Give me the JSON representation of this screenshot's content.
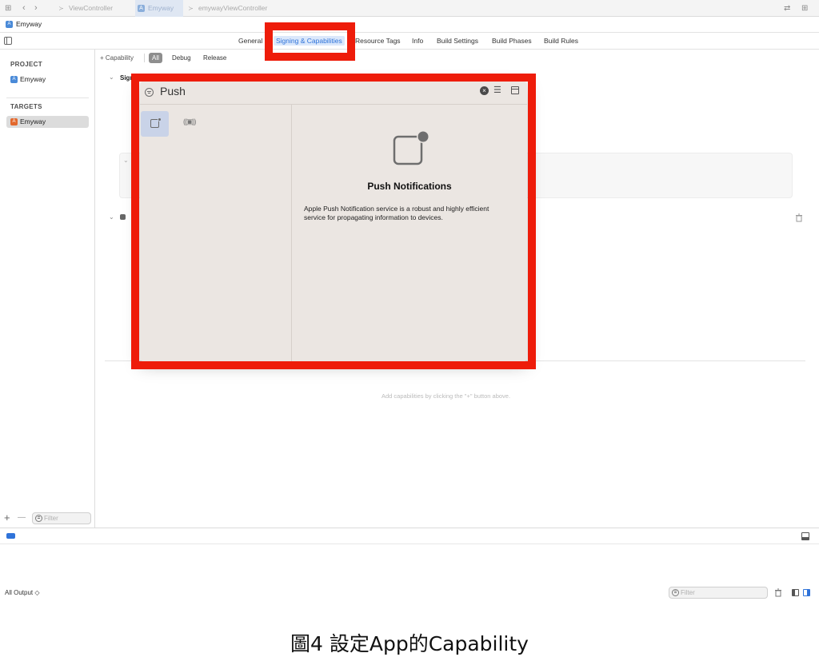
{
  "window_tabs": [
    {
      "label": "ViewController",
      "active": false
    },
    {
      "label": "Emyway",
      "active": true
    },
    {
      "label": "emywayViewController",
      "active": false
    }
  ],
  "path_bar": {
    "project": "Emyway"
  },
  "editor_tabs": [
    {
      "label": "General",
      "selected": false
    },
    {
      "label": "Signing & Capabilities",
      "selected": true
    },
    {
      "label": "Resource Tags",
      "selected": false
    },
    {
      "label": "Info",
      "selected": false
    },
    {
      "label": "Build Settings",
      "selected": false
    },
    {
      "label": "Build Phases",
      "selected": false
    },
    {
      "label": "Build Rules",
      "selected": false
    }
  ],
  "sidebar": {
    "project_heading": "PROJECT",
    "project_item": "Emyway",
    "targets_heading": "TARGETS",
    "target_item": "Emyway",
    "filter_placeholder": "Filter",
    "add_symbol": "+",
    "remove_symbol": "—"
  },
  "capability_bar": {
    "add_capability": "+ Capability",
    "configs": [
      "All",
      "Debug",
      "Release"
    ],
    "selected_config": "All"
  },
  "signing_section": {
    "title_fragment": "Sign"
  },
  "empty_hint": "Add capabilities by clicking the \"+\" button above.",
  "popup": {
    "search_value": "Push",
    "detail_title": "Push Notifications",
    "detail_description": "Apple Push Notification service is a robust and highly efficient service for propagating information to devices.",
    "results": [
      "push-notifications-icon",
      "broadcast-icon"
    ]
  },
  "debug_area": {
    "output_selector": "All Output ◇",
    "filter_placeholder": "Filter"
  },
  "caption": "圖4 設定App的Capability",
  "colors": {
    "highlight_red": "#ee1c0a",
    "accent_blue": "#2f73d9",
    "popup_bg": "#ebe6e2"
  }
}
